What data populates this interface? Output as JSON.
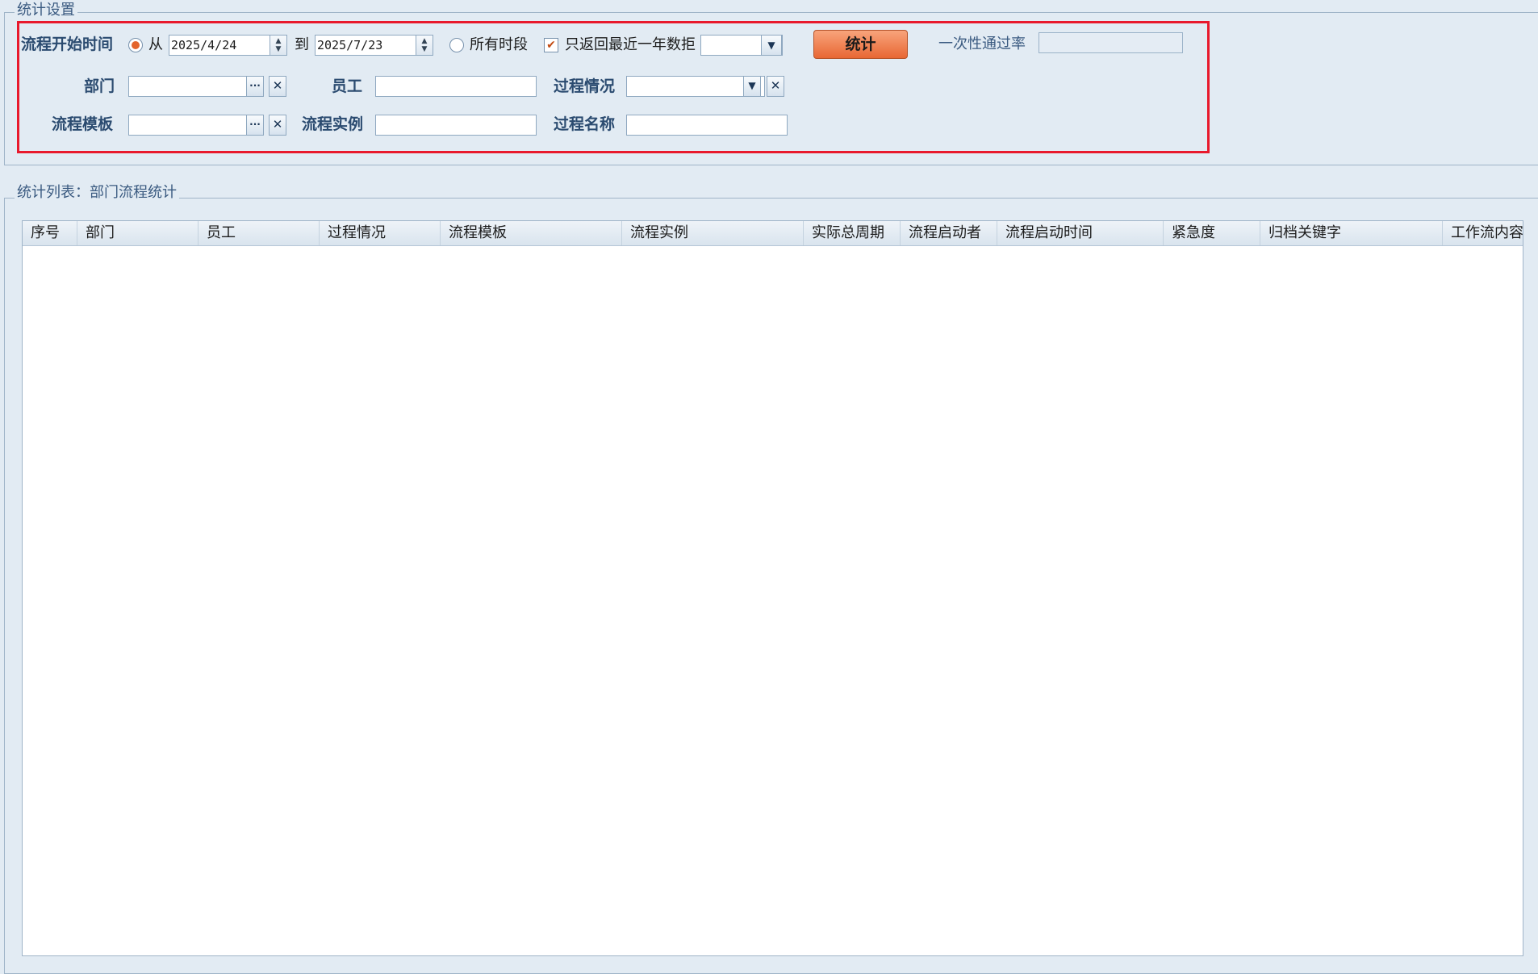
{
  "settings": {
    "legend": "统计设置",
    "start_time_label": "流程开始时间",
    "from_label": "从",
    "from_date": "2025/4/24",
    "to_label": "到",
    "to_date": "2025/7/23",
    "all_periods_label": "所有时段",
    "last_year_label": "只返回最近一年数拒",
    "run_button": "统计",
    "pass_rate_label": "一次性通过率",
    "pass_rate_value": "",
    "dept_label": "部门",
    "employee_label": "员工",
    "process_status_label": "过程情况",
    "template_label": "流程模板",
    "instance_label": "流程实例",
    "process_name_label": "过程名称",
    "ellipsis": "···",
    "clear": "✕"
  },
  "list": {
    "legend": "统计列表：部门流程统计",
    "columns": [
      "序号",
      "部门",
      "员工",
      "过程情况",
      "流程模板",
      "流程实例",
      "实际总周期",
      "流程启动者",
      "流程启动时间",
      "紧急度",
      "归档关键字",
      "工作流内容"
    ],
    "rows": []
  }
}
